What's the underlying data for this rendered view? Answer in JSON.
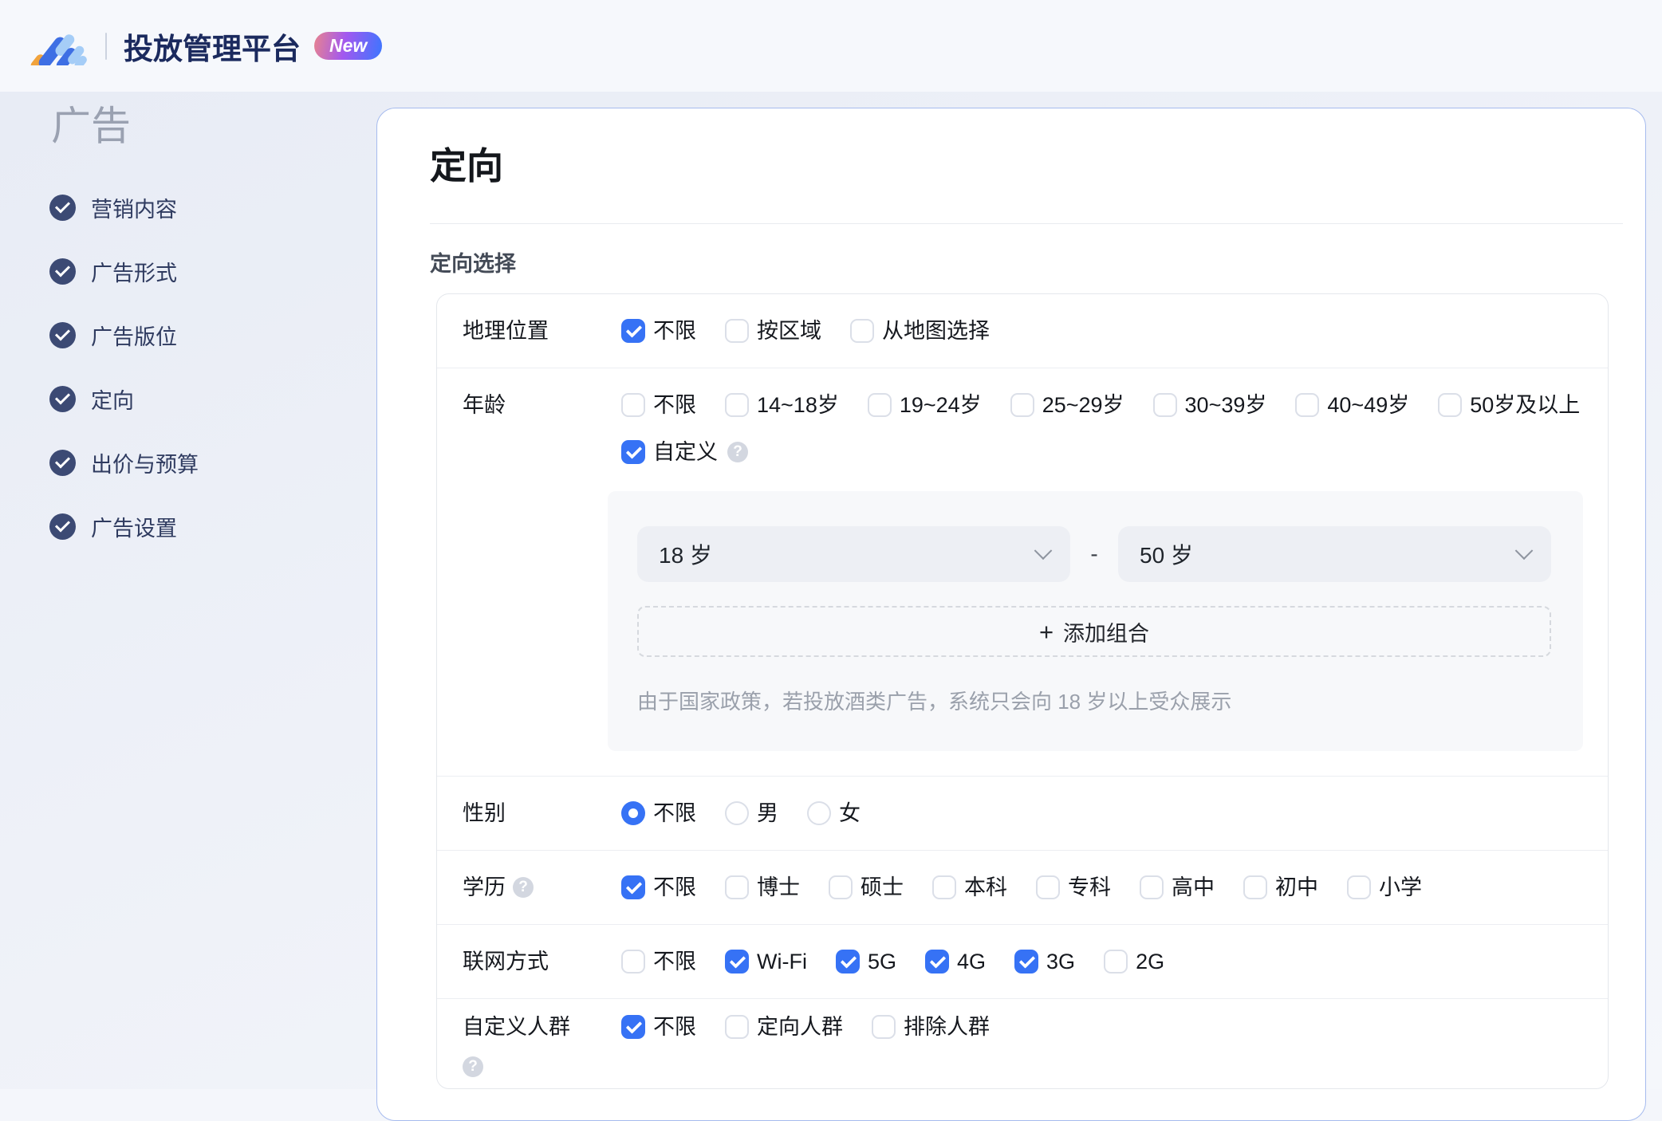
{
  "header": {
    "title": "投放管理平台",
    "badge": "New",
    "logo": "brand-logo"
  },
  "sidebar": {
    "heading": "广告",
    "items": [
      {
        "label": "营销内容",
        "done": true
      },
      {
        "label": "广告形式",
        "done": true
      },
      {
        "label": "广告版位",
        "done": true
      },
      {
        "label": "定向",
        "done": true
      },
      {
        "label": "出价与预算",
        "done": true
      },
      {
        "label": "广告设置",
        "done": true
      }
    ]
  },
  "card": {
    "title": "定向",
    "section_label": "定向选择",
    "help_glyph": "?",
    "rows": [
      {
        "id": "geo",
        "label": "地理位置",
        "type": "checkbox",
        "options": [
          {
            "label": "不限",
            "checked": true
          },
          {
            "label": "按区域",
            "checked": false
          },
          {
            "label": "从地图选择",
            "checked": false
          }
        ]
      },
      {
        "id": "age",
        "label": "年龄",
        "type": "checkbox",
        "options": [
          {
            "label": "不限",
            "checked": false
          },
          {
            "label": "14~18岁",
            "checked": false
          },
          {
            "label": "19~24岁",
            "checked": false
          },
          {
            "label": "25~29岁",
            "checked": false
          },
          {
            "label": "30~39岁",
            "checked": false
          },
          {
            "label": "40~49岁",
            "checked": false
          },
          {
            "label": "50岁及以上",
            "checked": false
          }
        ],
        "custom_option": {
          "label": "自定义",
          "checked": true,
          "help": true
        },
        "panel": {
          "from_value": "18 岁",
          "separator": "-",
          "to_value": "50 岁",
          "add_plus": "+",
          "add_label": "添加组合",
          "note": "由于国家政策，若投放酒类广告，系统只会向 18 岁以上受众展示"
        }
      },
      {
        "id": "gender",
        "label": "性别",
        "type": "radio",
        "options": [
          {
            "label": "不限",
            "checked": true
          },
          {
            "label": "男",
            "checked": false
          },
          {
            "label": "女",
            "checked": false
          }
        ]
      },
      {
        "id": "education",
        "label": "学历",
        "help": "inline",
        "type": "checkbox",
        "options": [
          {
            "label": "不限",
            "checked": true
          },
          {
            "label": "博士",
            "checked": false
          },
          {
            "label": "硕士",
            "checked": false
          },
          {
            "label": "本科",
            "checked": false
          },
          {
            "label": "专科",
            "checked": false
          },
          {
            "label": "高中",
            "checked": false
          },
          {
            "label": "初中",
            "checked": false
          },
          {
            "label": "小学",
            "checked": false
          }
        ]
      },
      {
        "id": "network",
        "label": "联网方式",
        "type": "checkbox",
        "options": [
          {
            "label": "不限",
            "checked": false
          },
          {
            "label": "Wi-Fi",
            "checked": true
          },
          {
            "label": "5G",
            "checked": true
          },
          {
            "label": "4G",
            "checked": true
          },
          {
            "label": "3G",
            "checked": true
          },
          {
            "label": "2G",
            "checked": false
          }
        ]
      },
      {
        "id": "custom-audience",
        "label": "自定义人群",
        "help": "below",
        "type": "checkbox",
        "options": [
          {
            "label": "不限",
            "checked": true
          },
          {
            "label": "定向人群",
            "checked": false
          },
          {
            "label": "排除人群",
            "checked": false
          }
        ]
      }
    ]
  },
  "colors": {
    "accent_blue": "#3672f5",
    "header_bg": "#f6f8fc",
    "title_navy": "#1b2a5e",
    "sidebar_icon": "#3c4a74",
    "card_border": "#a6bbee",
    "badge_gradient": [
      "#e8838f",
      "#a258ef",
      "#3b76ff"
    ],
    "panel_bg": "#f7f8fa",
    "select_bg": "#edeff4",
    "note_gray": "#9aa0ab",
    "logo_royal": "#3e6fe4",
    "logo_light": "#a5cdf7",
    "logo_orange": "#f1a33c"
  }
}
